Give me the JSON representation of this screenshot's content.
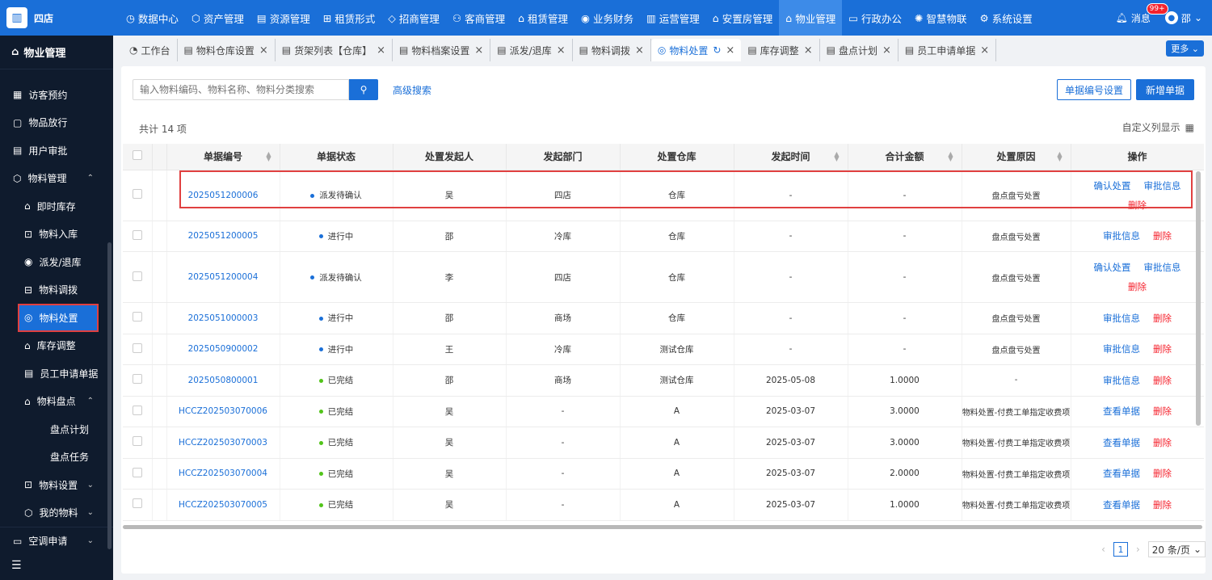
{
  "brand": {
    "name": "四店"
  },
  "topnav": [
    {
      "label": "数据中心",
      "icon": "dashboard-icon"
    },
    {
      "label": "资产管理",
      "icon": "cube-icon"
    },
    {
      "label": "资源管理",
      "icon": "building-icon"
    },
    {
      "label": "租赁形式",
      "icon": "grid-icon"
    },
    {
      "label": "招商管理",
      "icon": "tag-icon"
    },
    {
      "label": "客商管理",
      "icon": "users-icon"
    },
    {
      "label": "租赁管理",
      "icon": "home-icon"
    },
    {
      "label": "业务财务",
      "icon": "coin-icon"
    },
    {
      "label": "运营管理",
      "icon": "chart-icon"
    },
    {
      "label": "安置房管理",
      "icon": "house-icon"
    },
    {
      "label": "物业管理",
      "icon": "home-icon",
      "active": true
    },
    {
      "label": "行政办公",
      "icon": "monitor-icon"
    },
    {
      "label": "智慧物联",
      "icon": "iot-icon"
    },
    {
      "label": "系统设置",
      "icon": "gear-icon"
    }
  ],
  "topright": {
    "messages": "消息",
    "badge": "99+",
    "user": "邵"
  },
  "sidebar": {
    "header": "物业管理",
    "items": [
      {
        "label": "访客预约",
        "level": 1
      },
      {
        "label": "物品放行",
        "level": 1
      },
      {
        "label": "用户审批",
        "level": 1
      },
      {
        "label": "物料管理",
        "level": 1,
        "chevron": "up"
      },
      {
        "label": "即时库存",
        "level": 2
      },
      {
        "label": "物料入库",
        "level": 2
      },
      {
        "label": "派发/退库",
        "level": 2
      },
      {
        "label": "物料调拨",
        "level": 2
      },
      {
        "label": "物料处置",
        "level": 2,
        "active": true
      },
      {
        "label": "库存调整",
        "level": 2
      },
      {
        "label": "员工申请单据",
        "level": 2
      },
      {
        "label": "物料盘点",
        "level": 2,
        "chevron": "up"
      },
      {
        "label": "盘点计划",
        "level": 3
      },
      {
        "label": "盘点任务",
        "level": 3
      },
      {
        "label": "物料设置",
        "level": 2,
        "chevron": "down"
      },
      {
        "label": "我的物料",
        "level": 2,
        "chevron": "down"
      },
      {
        "label": "空调申请",
        "level": 1,
        "chevron": "down"
      }
    ]
  },
  "tabs": [
    {
      "label": "工作台",
      "closable": false
    },
    {
      "label": "物料仓库设置",
      "closable": true
    },
    {
      "label": "货架列表【仓库】",
      "closable": true
    },
    {
      "label": "物料档案设置",
      "closable": true
    },
    {
      "label": "派发/退库",
      "closable": true
    },
    {
      "label": "物料调拨",
      "closable": true
    },
    {
      "label": "物料处置",
      "closable": true,
      "active": true
    },
    {
      "label": "库存调整",
      "closable": true
    },
    {
      "label": "盘点计划",
      "closable": true
    },
    {
      "label": "员工申请单据",
      "closable": true
    }
  ],
  "more": "更多",
  "search": {
    "placeholder": "输入物料编码、物料名称、物料分类搜索",
    "advanced": "高级搜索"
  },
  "buttons": {
    "numbering": "单据编号设置",
    "add": "新增单据"
  },
  "total": "共计 14 项",
  "custom_columns": "自定义列显示",
  "columns": [
    "单据编号",
    "单据状态",
    "处置发起人",
    "发起部门",
    "处置仓库",
    "发起时间",
    "合计金额",
    "处置原因",
    "操作"
  ],
  "rows": [
    {
      "no": "2025051200006",
      "status": "派发待确认",
      "status_color": "#1a6fd8",
      "initiator": "吴",
      "dept": "四店",
      "warehouse": "仓库",
      "time": "-",
      "amount": "-",
      "reason": "盘点盘亏处置",
      "ops": [
        "确认处置",
        "审批信息",
        "删除"
      ],
      "tall": true
    },
    {
      "no": "2025051200005",
      "status": "进行中",
      "status_color": "#1a6fd8",
      "initiator": "邵",
      "dept": "冷库",
      "warehouse": "仓库",
      "time": "-",
      "amount": "-",
      "reason": "盘点盘亏处置",
      "ops": [
        "审批信息",
        "删除"
      ]
    },
    {
      "no": "2025051200004",
      "status": "派发待确认",
      "status_color": "#1a6fd8",
      "initiator": "李",
      "dept": "四店",
      "warehouse": "仓库",
      "time": "-",
      "amount": "-",
      "reason": "盘点盘亏处置",
      "ops": [
        "确认处置",
        "审批信息",
        "删除"
      ],
      "tall": true
    },
    {
      "no": "2025051000003",
      "status": "进行中",
      "status_color": "#1a6fd8",
      "initiator": "邵",
      "dept": "商场",
      "warehouse": "仓库",
      "time": "-",
      "amount": "-",
      "reason": "盘点盘亏处置",
      "ops": [
        "审批信息",
        "删除"
      ]
    },
    {
      "no": "2025050900002",
      "status": "进行中",
      "status_color": "#1a6fd8",
      "initiator": "王",
      "dept": "冷库",
      "warehouse": "测试仓库",
      "time": "-",
      "amount": "-",
      "reason": "盘点盘亏处置",
      "ops": [
        "审批信息",
        "删除"
      ]
    },
    {
      "no": "2025050800001",
      "status": "已完结",
      "status_color": "#52c41a",
      "initiator": "邵",
      "dept": "商场",
      "warehouse": "测试仓库",
      "time": "2025-05-08",
      "amount": "1.0000",
      "reason": "-",
      "ops": [
        "审批信息",
        "删除"
      ]
    },
    {
      "no": "HCCZ202503070006",
      "status": "已完结",
      "status_color": "#52c41a",
      "initiator": "吴",
      "dept": "-",
      "warehouse": "A",
      "time": "2025-03-07",
      "amount": "3.0000",
      "reason": "物料处置-付费工单指定收费项",
      "ops": [
        "查看单据",
        "删除"
      ]
    },
    {
      "no": "HCCZ202503070003",
      "status": "已完结",
      "status_color": "#52c41a",
      "initiator": "吴",
      "dept": "-",
      "warehouse": "A",
      "time": "2025-03-07",
      "amount": "3.0000",
      "reason": "物料处置-付费工单指定收费项",
      "ops": [
        "查看单据",
        "删除"
      ]
    },
    {
      "no": "HCCZ202503070004",
      "status": "已完结",
      "status_color": "#52c41a",
      "initiator": "吴",
      "dept": "-",
      "warehouse": "A",
      "time": "2025-03-07",
      "amount": "2.0000",
      "reason": "物料处置-付费工单指定收费项",
      "ops": [
        "查看单据",
        "删除"
      ]
    },
    {
      "no": "HCCZ202503070005",
      "status": "已完结",
      "status_color": "#52c41a",
      "initiator": "吴",
      "dept": "-",
      "warehouse": "A",
      "time": "2025-03-07",
      "amount": "1.0000",
      "reason": "物料处置-付费工单指定收费项",
      "ops": [
        "查看单据",
        "删除"
      ]
    }
  ],
  "pager": {
    "page": "1",
    "size": "20 条/页"
  }
}
